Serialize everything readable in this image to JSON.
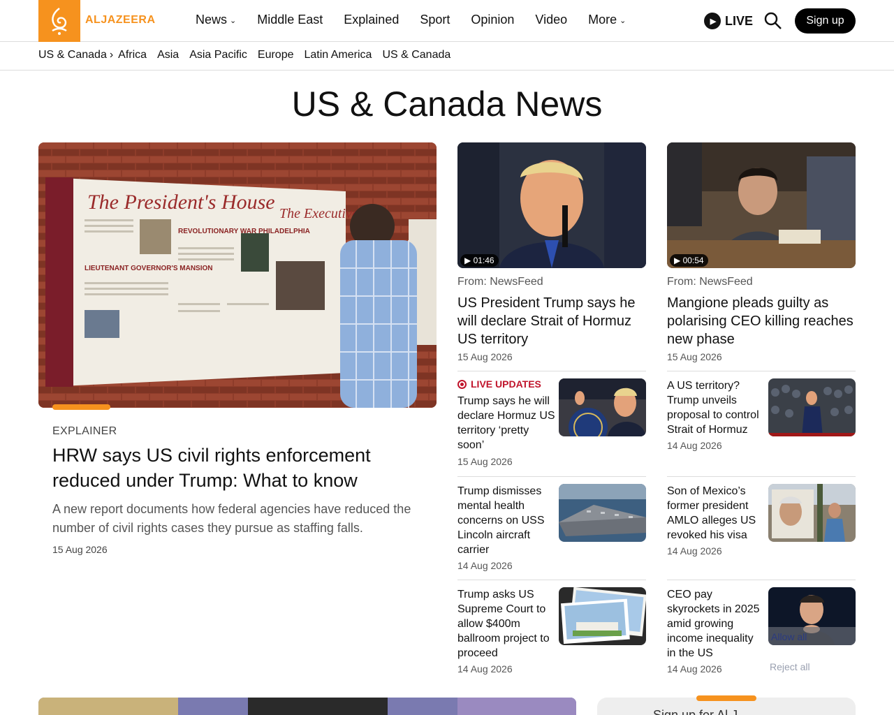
{
  "brand": {
    "name": "ALJAZEERA",
    "color": "#f6921e"
  },
  "nav": {
    "items": [
      {
        "label": "News",
        "has_dropdown": true
      },
      {
        "label": "Middle East",
        "has_dropdown": false
      },
      {
        "label": "Explained",
        "has_dropdown": false
      },
      {
        "label": "Sport",
        "has_dropdown": false
      },
      {
        "label": "Opinion",
        "has_dropdown": false
      },
      {
        "label": "Video",
        "has_dropdown": false
      },
      {
        "label": "More",
        "has_dropdown": true
      }
    ],
    "live_label": "LIVE",
    "signup_label": "Sign up"
  },
  "subnav": {
    "current": "US & Canada",
    "items": [
      "Africa",
      "Asia",
      "Asia Pacific",
      "Europe",
      "Latin America",
      "US & Canada"
    ]
  },
  "page_title": "US & Canada News",
  "feature": {
    "kicker": "EXPLAINER",
    "title": "HRW says US civil rights enforcement reduced under Trump: What to know",
    "summary": "A new report documents how federal agencies have reduced the number of civil rights cases they pursue as staffing falls.",
    "date": "15 Aug 2026",
    "image_text": {
      "headline": "The President's House",
      "sub1": "REVOLUTIONARY WAR PHILADELPHIA",
      "sub2": "LIEUTENANT GOVERNOR'S MANSION",
      "sub3": "The Executive"
    }
  },
  "top_cards": [
    {
      "duration": "01:46",
      "from": "From: NewsFeed",
      "title": "US President Trump says he will declare Strait of Hormuz US territory",
      "date": "15 Aug 2026"
    },
    {
      "duration": "00:54",
      "from": "From: NewsFeed",
      "title": "Mangione pleads guilty as polarising CEO killing reaches new phase",
      "date": "15 Aug 2026"
    }
  ],
  "left_list": [
    {
      "live_label": "LIVE UPDATES",
      "title": "Trump says he will declare Hormuz US territory ‘pretty soon’",
      "date": "15 Aug 2026"
    },
    {
      "title": "Trump dismisses mental health concerns on USS Lincoln aircraft carrier",
      "date": "14 Aug 2026"
    },
    {
      "title": "Trump asks US Supreme Court to allow $400m ballroom project to proceed",
      "date": "14 Aug 2026"
    }
  ],
  "right_list": [
    {
      "title": "A US territory? Trump unveils proposal to control Strait of Hormuz",
      "date": "14 Aug 2026"
    },
    {
      "title": "Son of Mexico’s former president AMLO alleges US revoked his visa",
      "date": "14 Aug 2026"
    },
    {
      "title": "CEO pay skyrockets in 2025 amid growing income inequality in the US",
      "date": "14 Aug 2026"
    }
  ],
  "consent": {
    "allow": "Allow all",
    "reject": "Reject all"
  },
  "bottom_panel_text": "Sign up for Al J"
}
